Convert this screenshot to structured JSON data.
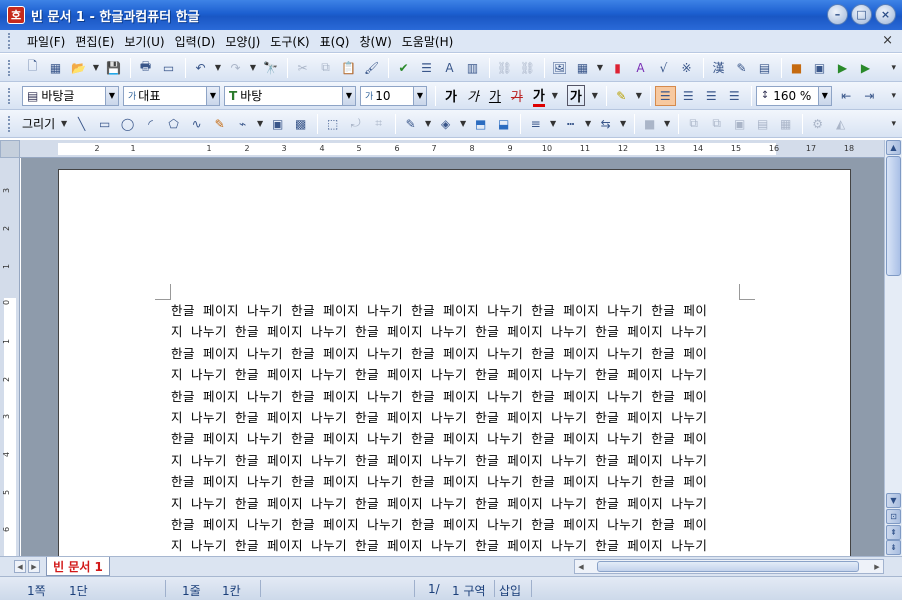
{
  "window": {
    "title": "빈 문서 1 - 한글과컴퓨터 한글",
    "app_icon": "호",
    "controls": {
      "minimize": "–",
      "maximize": "□",
      "close": "×"
    }
  },
  "menu": {
    "items": [
      "파일(F)",
      "편집(E)",
      "보기(U)",
      "입력(D)",
      "모양(J)",
      "도구(K)",
      "표(Q)",
      "창(W)",
      "도움말(H)"
    ],
    "close": "×"
  },
  "format_toolbar": {
    "style": "바탕글",
    "font_lang": "대표",
    "font_lang_prefix": "가",
    "font": "바탕",
    "font_prefix": "T",
    "size": "10",
    "size_prefix": "가",
    "bold": "가",
    "italic": "가",
    "underline": "가",
    "strike": "가",
    "color_text": "가",
    "highlight_text": "가",
    "zoom": "160 %"
  },
  "drawing_toolbar": {
    "label": "그리기"
  },
  "ruler": {
    "h_ticks": [
      "2",
      "1",
      "1",
      "2",
      "3",
      "4",
      "5",
      "6",
      "7",
      "8",
      "9",
      "10",
      "11",
      "12",
      "13",
      "14",
      "15",
      "16",
      "17",
      "18"
    ],
    "v_ticks": [
      "3",
      "2",
      "1",
      "0",
      "1",
      "2",
      "3",
      "4",
      "5",
      "6"
    ]
  },
  "document": {
    "lines": [
      "한글 페이지 나누기 한글 페이지 나누기 한글 페이지 나누기 한글 페이지 나누기 한글 페이",
      "지 나누기 한글 페이지 나누기 한글 페이지 나누기 한글 페이지 나누기 한글 페이지 나누기",
      "한글 페이지 나누기 한글 페이지 나누기 한글 페이지 나누기 한글 페이지 나누기 한글 페이",
      "지 나누기 한글 페이지 나누기 한글 페이지 나누기 한글 페이지 나누기 한글 페이지 나누기",
      "한글 페이지 나누기 한글 페이지 나누기 한글 페이지 나누기 한글 페이지 나누기 한글 페이",
      "지 나누기 한글 페이지 나누기 한글 페이지 나누기 한글 페이지 나누기 한글 페이지 나누기",
      "한글 페이지 나누기 한글 페이지 나누기 한글 페이지 나누기 한글 페이지 나누기 한글 페이",
      "지 나누기 한글 페이지 나누기 한글 페이지 나누기 한글 페이지 나누기 한글 페이지 나누기",
      "한글 페이지 나누기 한글 페이지 나누기 한글 페이지 나누기 한글 페이지 나누기 한글 페이",
      "지 나누기 한글 페이지 나누기 한글 페이지 나누기 한글 페이지 나누기 한글 페이지 나누기",
      "한글 페이지 나누기 한글 페이지 나누기 한글 페이지 나누기 한글 페이지 나누기 한글 페이",
      "지 나누기 한글 페이지 나누기 한글 페이지 나누기 한글 페이지 나누기 한글 페이지 나누기"
    ]
  },
  "tabs": {
    "active": "빈 문서 1"
  },
  "status": {
    "page": "1쪽",
    "column": "1단",
    "line": "1줄",
    "char": "1칸",
    "page_count": "1/",
    "section": "1 구역",
    "mode": "삽입"
  },
  "colors": {
    "titlebar": "#1c5fd0",
    "tab_text": "#d21818",
    "status_text": "#1b3f7a"
  }
}
